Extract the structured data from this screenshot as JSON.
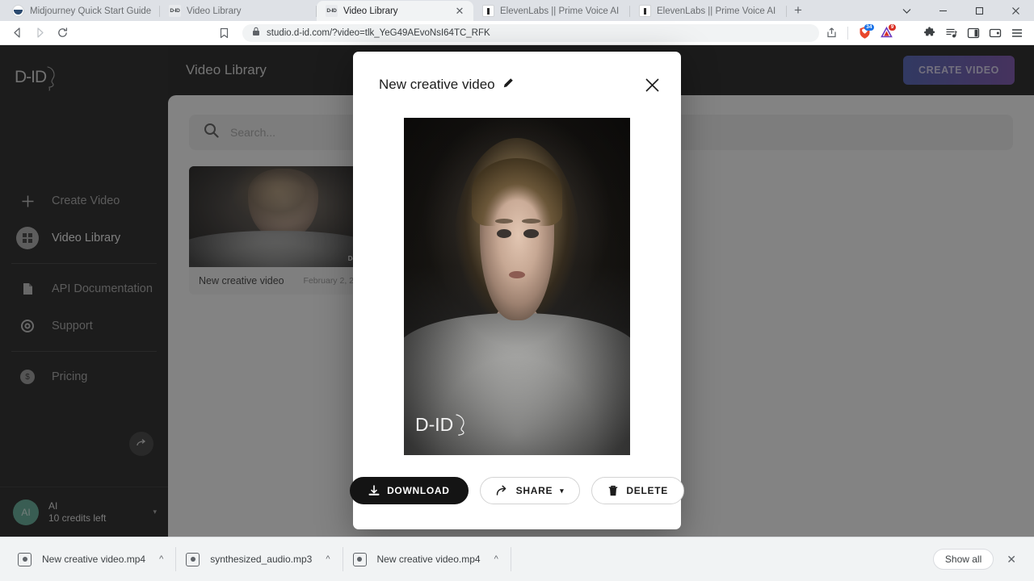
{
  "browser": {
    "tabs": [
      {
        "title": "Midjourney Quick Start Guide",
        "favicon": "midjourney-icon",
        "active": false
      },
      {
        "title": "Video Library",
        "favicon": "did-icon",
        "active": false
      },
      {
        "title": "Video Library",
        "favicon": "did-icon",
        "active": true
      },
      {
        "title": "ElevenLabs || Prime Voice AI",
        "favicon": "elevenlabs-icon",
        "active": false
      },
      {
        "title": "ElevenLabs || Prime Voice AI",
        "favicon": "elevenlabs-icon",
        "active": false
      }
    ],
    "new_tab_label": "+",
    "window_controls": {
      "list": "⌄",
      "minimize": "—",
      "maximize": "❐",
      "close": "✕"
    },
    "toolbar": {
      "back": "back-icon",
      "forward": "forward-icon",
      "reload": "reload-icon",
      "bookmark": "bookmark-icon",
      "url": "studio.d-id.com/?video=tlk_YeG49AEvoNsI64TC_RFK",
      "lock": "lock-icon",
      "share": "share-icon",
      "extensions": [
        {
          "name": "shield-extension-icon",
          "badge": "34",
          "color": "#d93025"
        },
        {
          "name": "triangle-extension-icon",
          "badge": "9",
          "color": "#6d3bbf"
        }
      ],
      "puzzle": "puzzle-icon",
      "playlist": "playlist-icon",
      "sidepanel": "side-panel-icon",
      "wallet": "wallet-icon",
      "menu": "menu-icon"
    }
  },
  "app": {
    "brand": "D-ID",
    "sidebar": {
      "items": [
        {
          "label": "Create Video",
          "icon": "plus-icon",
          "active": false
        },
        {
          "label": "Video Library",
          "icon": "grid-icon",
          "active": true
        },
        {
          "label": "API Documentation",
          "icon": "document-icon",
          "active": false
        },
        {
          "label": "Support",
          "icon": "lifebuoy-icon",
          "active": false
        },
        {
          "label": "Pricing",
          "icon": "dollar-icon",
          "active": false
        }
      ],
      "collapse_icon": "collapse-arrow-icon",
      "user": {
        "avatar_initials": "AI",
        "name": "AI",
        "credits": "10 credits left",
        "caret": "▾"
      }
    },
    "header": {
      "title": "Video Library",
      "create_button": "CREATE VIDEO"
    },
    "search": {
      "placeholder": "Search...",
      "value": "",
      "icon": "search-icon"
    },
    "library": {
      "cards": [
        {
          "name": "New creative video",
          "date": "February 2, 2",
          "watermark": "D-ID"
        }
      ]
    }
  },
  "modal": {
    "title": "New creative video",
    "edit_icon": "pencil-icon",
    "close_icon": "close-icon",
    "video_watermark": "D-ID",
    "buttons": [
      {
        "label": "DOWNLOAD",
        "icon": "download-icon",
        "style": "primary"
      },
      {
        "label": "SHARE",
        "icon": "share-arrow-icon",
        "style": "outline",
        "caret": "▾"
      },
      {
        "label": "DELETE",
        "icon": "trash-icon",
        "style": "outline"
      }
    ]
  },
  "downloads": {
    "items": [
      {
        "name": "New creative video.mp4",
        "icon": "media-file-icon",
        "caret": "^"
      },
      {
        "name": "synthesized_audio.mp3",
        "icon": "media-file-icon",
        "caret": "^"
      },
      {
        "name": "New creative video.mp4",
        "icon": "media-file-icon",
        "caret": "^"
      }
    ],
    "show_all": "Show all",
    "close": "✕"
  },
  "colors": {
    "accent_gradient_start": "#3c4fa8",
    "accent_gradient_end": "#6b3fa0",
    "sidebar_bg": "#0e0e0e",
    "panel_bg": "#f2f2f2",
    "avatar_green": "#4f9e87"
  }
}
